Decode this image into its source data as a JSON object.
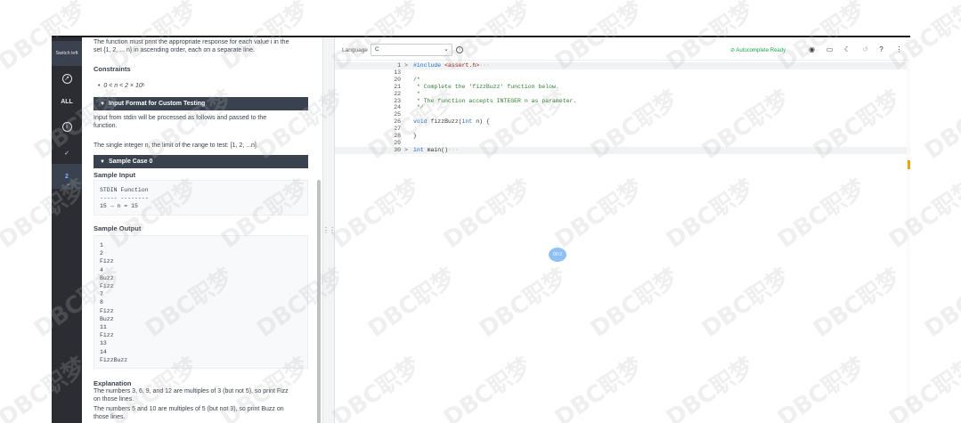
{
  "rail": {
    "switch_label": "Switch left",
    "all_label": "ALL",
    "info_icon": "info-icon",
    "check": "✓",
    "question_number": "2",
    "chevron": "⌄"
  },
  "problem": {
    "intro_line1": "The function must print the appropriate response for each value i in the",
    "intro_line2": "set {1, 2, ... n} in ascending order, each on a separate line.",
    "constraints_title": "Constraints",
    "constraint_1": "0 < n < 2 × 10⁵",
    "input_format_title": "Input Format for Custom Testing",
    "input_format_line1": "Input from stdin will be processed as follows and passed to the",
    "input_format_line2": "function.",
    "input_format_line3": "The single integer n, the limit of the range to test: [1, 2, ...n].",
    "sample_case_title": "Sample Case 0",
    "sample_input_title": "Sample Input",
    "sample_input_lines": [
      "STDIN     Function",
      "-----     --------",
      "15    →   n = 15"
    ],
    "sample_output_title": "Sample Output",
    "sample_output_lines": [
      "1",
      "2",
      "Fizz",
      "4",
      "Buzz",
      "Fizz",
      "7",
      "8",
      "Fizz",
      "Buzz",
      "11",
      "Fizz",
      "13",
      "14",
      "FizzBuzz"
    ],
    "explanation_title": "Explanation",
    "explanation_line1": "The numbers 3, 6, 9, and 12 are multiples of 3 (but not 5), so print Fizz",
    "explanation_line2": "on those lines.",
    "explanation_line3": "The numbers 5 and 10 are multiples of 5 (but not 3), so print Buzz on",
    "explanation_line4": "those lines."
  },
  "editor": {
    "language_label": "Language",
    "language_value": "C",
    "autocomplete_status": "Autocomplete Ready",
    "icons": [
      "info-icon",
      "check-circle-icon",
      "eye-icon",
      "keyboard-icon",
      "moon-icon",
      "undo-icon",
      "help-icon",
      "more-icon"
    ],
    "lines": [
      {
        "num": "1",
        "fold": ">",
        "text": "#include <assert.h>···"
      },
      {
        "num": "13",
        "fold": "",
        "text": ""
      },
      {
        "num": "20",
        "fold": "",
        "text": "/*"
      },
      {
        "num": "21",
        "fold": "",
        "text": " * Complete the 'fizzBuzz' function below."
      },
      {
        "num": "22",
        "fold": "",
        "text": " *"
      },
      {
        "num": "23",
        "fold": "",
        "text": " * The function accepts INTEGER n as parameter."
      },
      {
        "num": "24",
        "fold": "",
        "text": " */"
      },
      {
        "num": "25",
        "fold": "",
        "text": ""
      },
      {
        "num": "26",
        "fold": "",
        "text": "void fizzBuzz(int n) {"
      },
      {
        "num": "27",
        "fold": "",
        "text": ""
      },
      {
        "num": "28",
        "fold": "",
        "text": "}"
      },
      {
        "num": "29",
        "fold": "",
        "text": ""
      },
      {
        "num": "30",
        "fold": ">",
        "text": "int main()···"
      }
    ],
    "cursor_bubble": "00:3"
  },
  "watermark_text": "DBC职梦"
}
